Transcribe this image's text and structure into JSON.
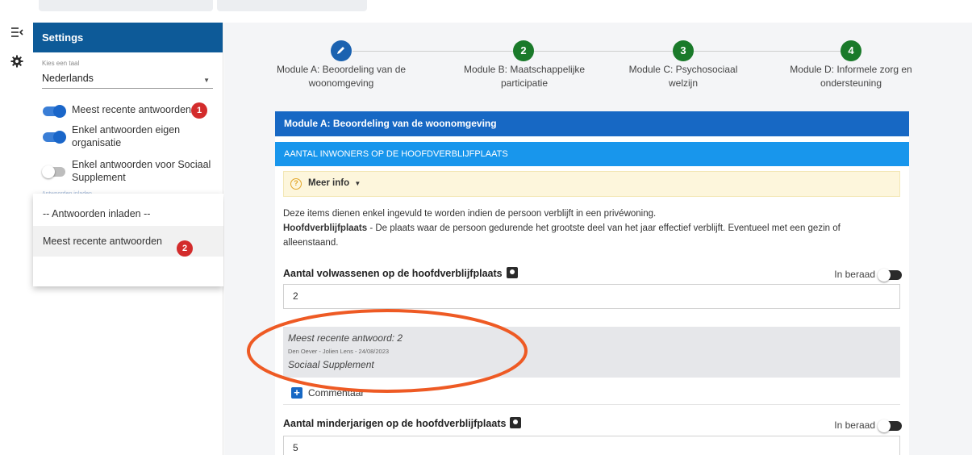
{
  "settings": {
    "title": "Settings",
    "language_label": "Kies een taal",
    "language_value": "Nederlands",
    "toggles": [
      {
        "label": "Meest recente antwoorden",
        "on": true,
        "badge": "1"
      },
      {
        "label": "Enkel antwoorden eigen organisatie",
        "on": true
      },
      {
        "label": "Enkel antwoorden voor Sociaal Supplement",
        "on": false
      }
    ],
    "hidden_label": "Antwoorden inladen",
    "dropdown": {
      "items": [
        {
          "label": "-- Antwoorden inladen --"
        },
        {
          "label": "Meest recente antwoorden",
          "badge": "2",
          "highlighted": true
        }
      ]
    }
  },
  "stepper": {
    "steps": [
      {
        "number": "",
        "icon": "pencil-icon",
        "label": "Module A: Beoordeling van de woonomgeving",
        "state": "active"
      },
      {
        "number": "2",
        "label": "Module B: Maatschappelijke participatie",
        "state": "done"
      },
      {
        "number": "3",
        "label": "Module C: Psychosociaal welzijn",
        "state": "done"
      },
      {
        "number": "4",
        "label": "Module D: Informele zorg en ondersteuning",
        "state": "done"
      }
    ]
  },
  "module": {
    "title": "Module A: Beoordeling van de woonomgeving",
    "section_title": "AANTAL INWONERS OP DE HOOFDVERBLIJFPLAATS",
    "info_toggle": "Meer info",
    "description_line1": "Deze items dienen enkel ingevuld te worden indien de persoon verblijft in een privéwoning.",
    "description_term": "Hoofdverblijfplaats",
    "description_line2": " - De plaats waar de persoon gedurende het grootste deel van het jaar effectief verblijft. Eventueel met een gezin of alleenstaand.",
    "questions": [
      {
        "label": "Aantal volwassenen op de hoofdverblijfplaats",
        "in_beraad_label": "In beraad",
        "value": "2",
        "recent": {
          "title": "Meest recente antwoord: 2",
          "meta": "Den Oever - Jolien Lens - 24/08/2023",
          "source": "Sociaal Supplement"
        },
        "comment_label": "Commentaar"
      },
      {
        "label": "Aantal minderjarigen op de hoofdverblijfplaats",
        "in_beraad_label": "In beraad",
        "value": "5"
      }
    ]
  },
  "colors": {
    "header_blue": "#0d5a98",
    "module_blue": "#1768c4",
    "section_blue": "#1896ec",
    "step_active": "#1b62b0",
    "step_done": "#1a7a2a",
    "badge_red": "#d32c2c",
    "annotation_orange": "#ee5a24"
  }
}
